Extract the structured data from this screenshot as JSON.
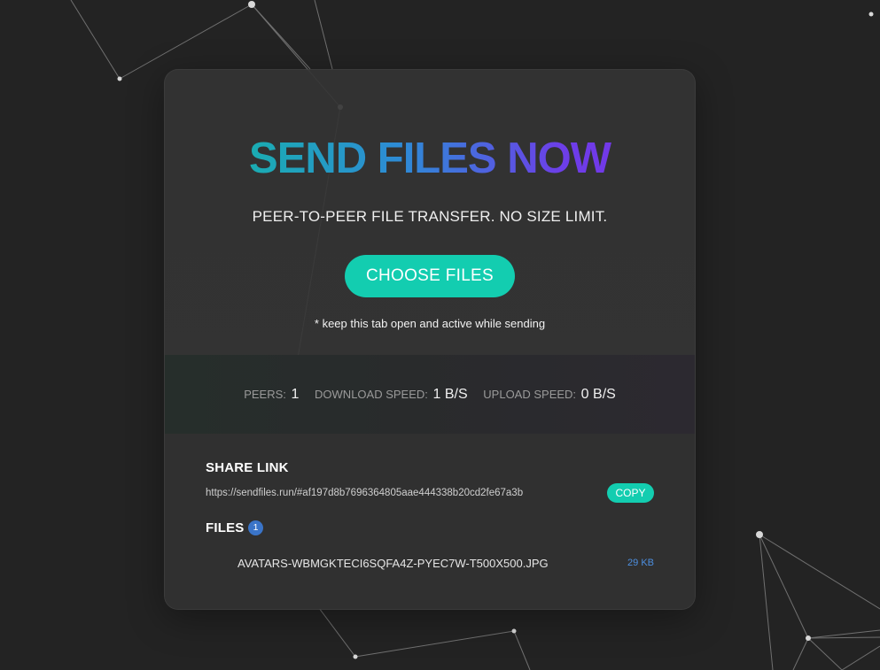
{
  "hero": {
    "title": "SEND FILES NOW",
    "tagline": "PEER-TO-PEER FILE TRANSFER. NO SIZE LIMIT.",
    "choose_button": "CHOOSE FILES",
    "hint": "* keep this tab open and active while sending"
  },
  "stats": {
    "peers_label": "PEERS:",
    "peers_value": "1",
    "download_label": "DOWNLOAD SPEED:",
    "download_value": "1 B/S",
    "upload_label": "UPLOAD SPEED:",
    "upload_value": "0 B/S"
  },
  "share": {
    "label": "SHARE LINK",
    "url": "https://sendfiles.run/#af197d8b7696364805aae444338b20cd2fe67a3b",
    "copy_button": "COPY"
  },
  "files": {
    "label": "FILES",
    "count": "1",
    "items": [
      {
        "name": "AVATARS-WBMGKTECI6SQFA4Z-PYEC7W-T500X500.JPG",
        "size": "29 KB"
      }
    ]
  },
  "colors": {
    "accent": "#13cdb0",
    "title_gradient_start": "#0fbf9e",
    "title_gradient_mid": "#2e8ad6",
    "title_gradient_end": "#7a2fe6",
    "badge": "#3a74c8",
    "file_size": "#4d8fe0"
  }
}
